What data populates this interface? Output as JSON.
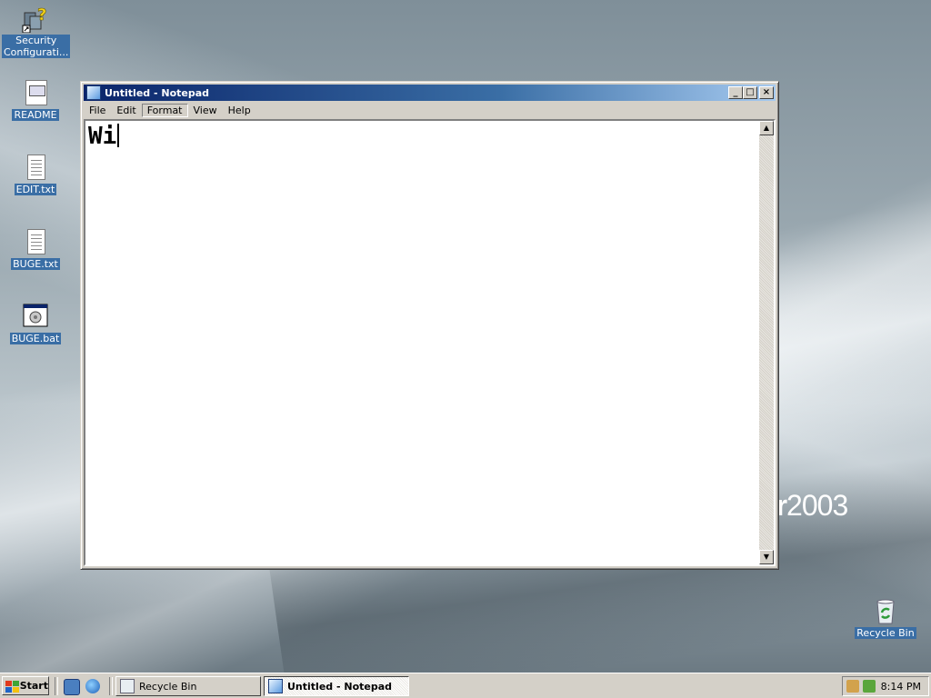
{
  "desktop": {
    "brand_tail": "ver",
    "brand_year": "2003",
    "icons": [
      {
        "label_line1": "Security",
        "label_line2": "Configurati...",
        "icon": "security-config-icon"
      },
      {
        "label": "README",
        "icon": "readme-icon"
      },
      {
        "label": "EDIT.txt",
        "icon": "text-file-icon"
      },
      {
        "label": "BUGE.txt",
        "icon": "text-file-icon"
      },
      {
        "label": "BUGE.bat",
        "icon": "batch-file-icon"
      },
      {
        "label": "Recycle Bin",
        "icon": "recycle-bin-icon"
      }
    ]
  },
  "notepad": {
    "title": "Untitled - Notepad",
    "menu": [
      "File",
      "Edit",
      "Format",
      "View",
      "Help"
    ],
    "active_menu": "Format",
    "content": "Wi",
    "window_buttons": {
      "minimize": "_",
      "maximize": "□",
      "close": "×"
    }
  },
  "taskbar": {
    "start_label": "Start",
    "tasks": [
      {
        "label": "Recycle Bin",
        "active": false
      },
      {
        "label": "Untitled - Notepad",
        "active": true
      }
    ],
    "clock": "8:14 PM"
  },
  "colors": {
    "title_active": "#0a246a",
    "face": "#d4d0c8",
    "selection": "#3a6ea5"
  }
}
